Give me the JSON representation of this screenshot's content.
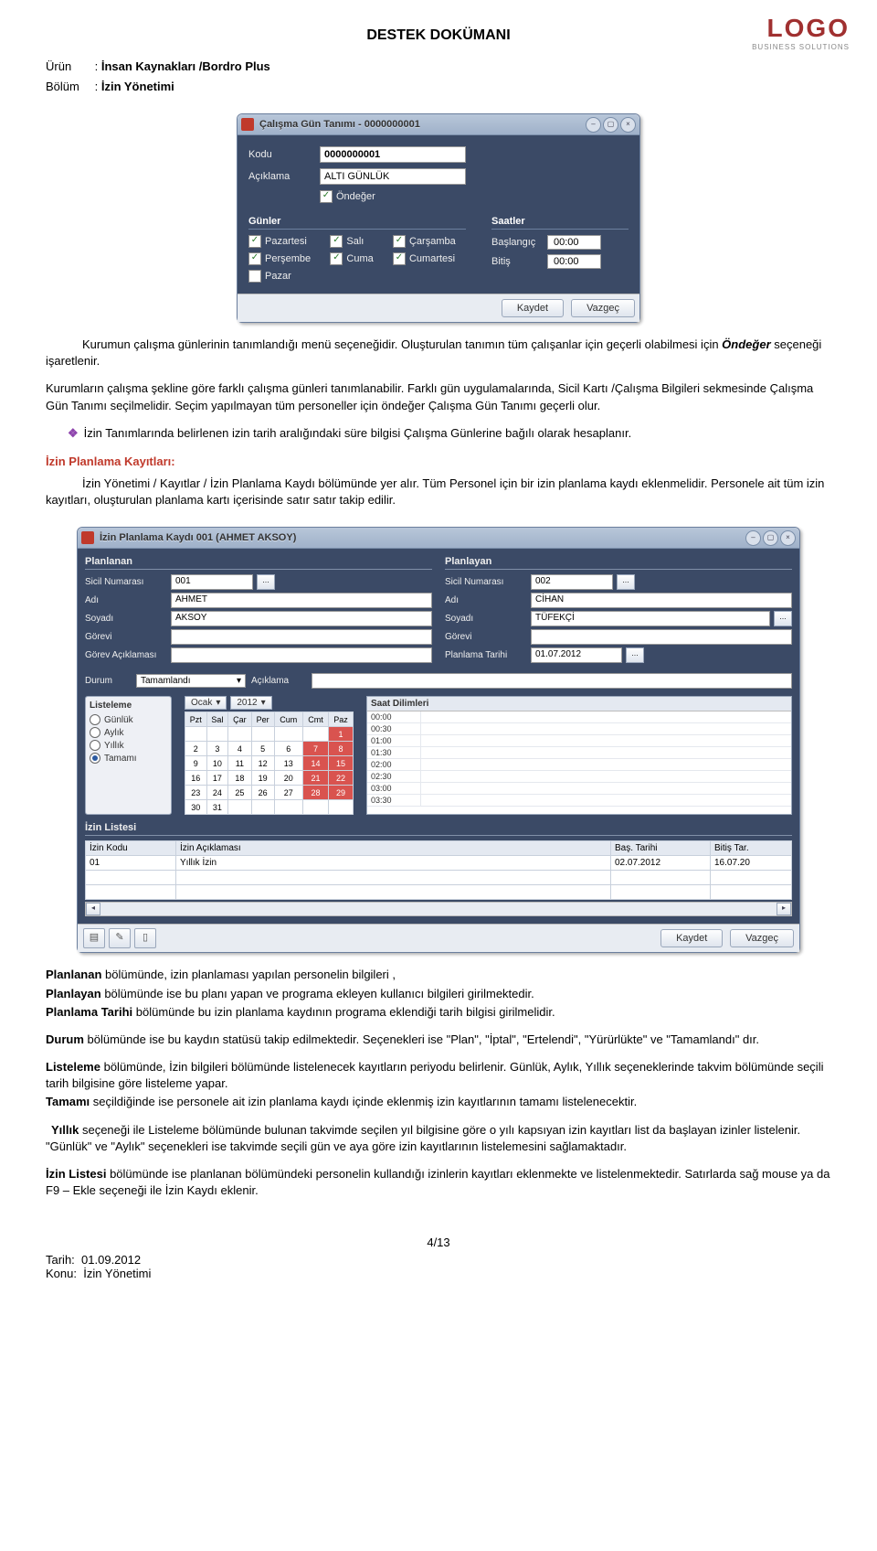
{
  "doc": {
    "title": "DESTEK DOKÜMANI",
    "logo_text": "LOGO",
    "logo_sub": "BUSINESS SOLUTIONS",
    "urun_label": "Ürün",
    "urun_value": "İnsan Kaynakları /Bordro Plus",
    "bolum_label": "Bölüm",
    "bolum_value": "İzin Yönetimi"
  },
  "dialog1": {
    "title": "Çalışma Gün Tanımı - 0000000001",
    "kodu_label": "Kodu",
    "kodu_value": "0000000001",
    "aciklama_label": "Açıklama",
    "aciklama_value": "ALTI GÜNLÜK",
    "ondefer_label": "Öndeğer",
    "gunler_label": "Günler",
    "saatler_label": "Saatler",
    "days": {
      "pzt": "Pazartesi",
      "sal": "Salı",
      "car": "Çarşamba",
      "per": "Perşembe",
      "cum": "Cuma",
      "cmt": "Cumartesi",
      "paz": "Pazar"
    },
    "baslangic_label": "Başlangıç",
    "baslangic_value": "00:00",
    "bitis_label": "Bitiş",
    "bitis_value": "00:00",
    "kaydet": "Kaydet",
    "vazgec": "Vazgeç"
  },
  "para": {
    "p1a": "Kurumun çalışma günlerinin tanımlandığı menü seçeneğidir.  Oluşturulan tanımın tüm çalışanlar için geçerli olabilmesi için ",
    "p1b": "Öndeğer",
    "p1c": " seçeneği işaretlenir.",
    "p2": "Kurumların çalışma şekline göre farklı çalışma günleri tanımlanabilir. Farklı gün uygulamalarında, Sicil Kartı /Çalışma Bilgileri sekmesinde Çalışma Gün Tanımı seçilmelidir. Seçim yapılmayan tüm personeller için öndeğer Çalışma Gün Tanımı geçerli olur.",
    "bul1": "İzin Tanımlarında belirlenen izin tarih aralığındaki süre bilgisi Çalışma Günlerine bağılı olarak hesaplanır.",
    "sec_title": "İzin Planlama Kayıtları:",
    "p3": "İzin Yönetimi / Kayıtlar / İzin Planlama Kaydı bölümünde yer alır. Tüm Personel için bir  izin planlama kaydı eklenmelidir. Personele ait tüm izin kayıtları, oluşturulan planlama kartı içerisinde satır satır takip edilir."
  },
  "dialog2": {
    "title": "İzin Planlama Kaydı  001 (AHMET AKSOY)",
    "planlanan": "Planlanan",
    "planlayan": "Planlayan",
    "sicil_label": "Sicil Numarası",
    "adi_label": "Adı",
    "soyadi_label": "Soyadı",
    "gorevi_label": "Görevi",
    "gorev_ack_label": "Görev Açıklaması",
    "plan_tarih_label": "Planlama Tarihi",
    "left": {
      "sicil": "001",
      "adi": "AHMET",
      "soyadi": "AKSOY",
      "gorevi": "",
      "ga": ""
    },
    "right": {
      "sicil": "002",
      "adi": "CİHAN",
      "soyadi": "TÜFEKÇİ",
      "gorevi": "",
      "pt": "01.07.2012"
    },
    "durum_label": "Durum",
    "durum_value": "Tamamlandı",
    "aciklama_label": "Açıklama",
    "listeleme": "Listeleme",
    "radios": {
      "g": "Günlük",
      "a": "Aylık",
      "y": "Yıllık",
      "t": "Tamamı"
    },
    "month": "Ocak",
    "year": "2012",
    "dayhdrs": [
      "Pzt",
      "Sal",
      "Çar",
      "Per",
      "Cum",
      "Cmt",
      "Paz"
    ],
    "calendar": [
      [
        "",
        "",
        "",
        "",
        "",
        "",
        "1"
      ],
      [
        "2",
        "3",
        "4",
        "5",
        "6",
        "7",
        "8"
      ],
      [
        "9",
        "10",
        "11",
        "12",
        "13",
        "14",
        "15"
      ],
      [
        "16",
        "17",
        "18",
        "19",
        "20",
        "21",
        "22"
      ],
      [
        "23",
        "24",
        "25",
        "26",
        "27",
        "28",
        "29"
      ],
      [
        "30",
        "31",
        "",
        "",
        "",
        "",
        ""
      ]
    ],
    "redcells": [
      "1",
      "7",
      "8",
      "14",
      "15",
      "21",
      "22",
      "28",
      "29"
    ],
    "saat_hdr": "Saat Dilimleri",
    "saat_rows": [
      [
        "00:00",
        ""
      ],
      [
        "00:30",
        ""
      ],
      [
        "01:00",
        ""
      ],
      [
        "01:30",
        ""
      ],
      [
        "02:00",
        ""
      ],
      [
        "02:30",
        ""
      ],
      [
        "03:00",
        ""
      ],
      [
        "03:30",
        ""
      ]
    ],
    "izin_listesi_label": "İzin Listesi",
    "list_hdr": {
      "kod": "İzin Kodu",
      "ack": "İzin Açıklaması",
      "bas": "Baş. Tarihi",
      "bit": "Bitiş Tar."
    },
    "list_row": {
      "kod": "01",
      "ack": "Yıllık İzin",
      "bas": "02.07.2012",
      "bit": "16.07.20"
    },
    "kaydet": "Kaydet",
    "vazgec": "Vazgeç"
  },
  "tail": {
    "p1a": "Planlanan",
    "p1b": " bölümünde, izin planlaması yapılan personelin bilgileri ,",
    "p2a": "Planlayan",
    "p2b": " bölümünde ise bu planı yapan ve programa ekleyen kullanıcı bilgileri girilmektedir.",
    "p3a": "Planlama Tarihi",
    "p3b": " bölümünde bu izin planlama kaydının programa eklendiği tarih bilgisi girilmelidir.",
    "p4a": "Durum",
    "p4b": " bölümünde ise bu kaydın statüsü takip edilmektedir. Seçenekleri ise \"Plan\", \"İptal\", \"Ertelendi\", \"Yürürlükte\" ve \"Tamamlandı\" dır.",
    "p5a": "Listeleme",
    "p5b": " bölümünde, İzin bilgileri bölümünde listelenecek kayıtların periyodu belirlenir.  Günlük, Aylık, Yıllık seçeneklerinde takvim bölümünde seçili tarih bilgisine göre listeleme yapar.",
    "p6a": "Tamamı",
    "p6b": " seçildiğinde ise personele ait izin planlama kaydı içinde eklenmiş izin kayıtlarının tamamı listelenecektir.",
    "p7a": "Yıllık",
    "p7b": " seçeneği ile Listeleme bölümünde bulunan takvimde seçilen yıl bilgisine göre o yılı kapsıyan izin kayıtları list da başlayan izinler listelenir. \"Günlük\" ve \"Aylık\" seçenekleri ise takvimde seçili gün ve aya göre izin kayıtlarının listelemesini sağlamaktadır.",
    "p8a": "İzin Listesi",
    "p8b": " bölümünde ise planlanan bölümündeki personelin kullandığı izinlerin kayıtları eklenmekte ve listelenmektedir. Satırlarda sağ mouse ya da F9 – Ekle seçeneği ile İzin Kaydı eklenir."
  },
  "footer": {
    "page": "4/13",
    "tarih_label": "Tarih:",
    "tarih_value": "01.09.2012",
    "konu_label": "Konu:",
    "konu_value": "İzin Yönetimi"
  }
}
